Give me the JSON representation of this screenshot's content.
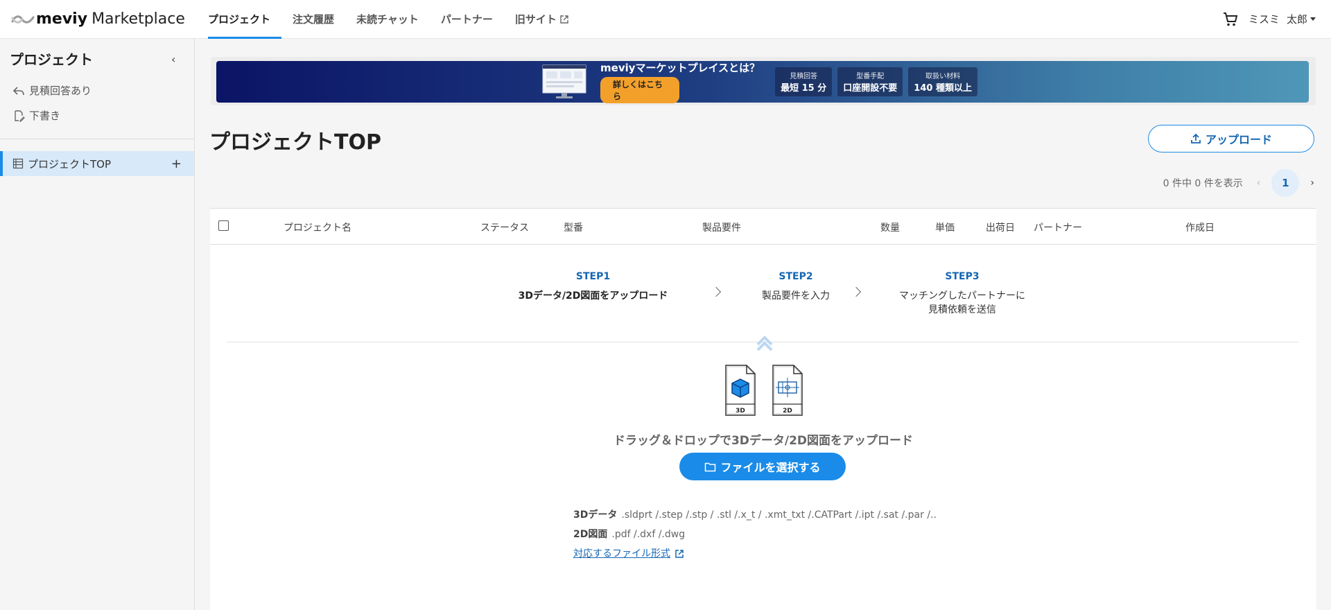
{
  "header": {
    "brand": "meviy",
    "brand_suffix": "Marketplace",
    "nav": [
      {
        "label": "プロジェクト"
      },
      {
        "label": "注文履歴"
      },
      {
        "label": "未読チャット"
      },
      {
        "label": "パートナー"
      },
      {
        "label": "旧サイト"
      }
    ],
    "company": "ミスミ",
    "user": "太郎"
  },
  "sidebar": {
    "title": "プロジェクト",
    "collapse": "‹",
    "links": [
      {
        "label": "見積回答あり"
      },
      {
        "label": "下書き"
      }
    ],
    "active_item": "プロジェクトTOP",
    "add": "+"
  },
  "banner": {
    "headline": "meviyマーケットプレイスとは？",
    "cta": "詳しくはこちら",
    "stats": [
      {
        "label": "見積回答",
        "value": "最短 15 分"
      },
      {
        "label": "型番手配",
        "value": "口座開設不要"
      },
      {
        "label": "取扱い材料",
        "value": "140 種類以上"
      }
    ]
  },
  "main": {
    "title": "プロジェクトTOP",
    "upload_button": "アップロード",
    "pager": {
      "summary": "0 件中 0 件を表示",
      "prev": "‹",
      "page": "1",
      "next": "›"
    },
    "columns": [
      "プロジェクト名",
      "ステータス",
      "型番",
      "製品要件",
      "数量",
      "単価",
      "出荷日",
      "パートナー",
      "作成日"
    ]
  },
  "steps": [
    {
      "num": "STEP1",
      "text": "3Dデータ/2D図面をアップロード"
    },
    {
      "num": "STEP2",
      "text": "製品要件を入力"
    },
    {
      "num": "STEP3",
      "text_line1": "マッチングしたパートナーに",
      "text_line2": "見積依頼を送信"
    }
  ],
  "dropzone": {
    "label_3d": "3D",
    "label_2d": "2D",
    "text": "ドラッグ＆ドロップで3Dデータ/2D図面をアップロード",
    "button": "ファイルを選択する"
  },
  "formats": {
    "d3_label": "3Dデータ",
    "d3_list": ".sldprt /.step /.stp / .stl /.x_t / .xmt_txt /.CATPart /.ipt /.sat /.par /..",
    "d2_label": "2D図面",
    "d2_list": ".pdf /.dxf /.dwg",
    "link": "対応するファイル形式"
  },
  "colors": {
    "accent": "#1a8be8",
    "link": "#1566b3",
    "active_bg": "#d8e9f9"
  }
}
